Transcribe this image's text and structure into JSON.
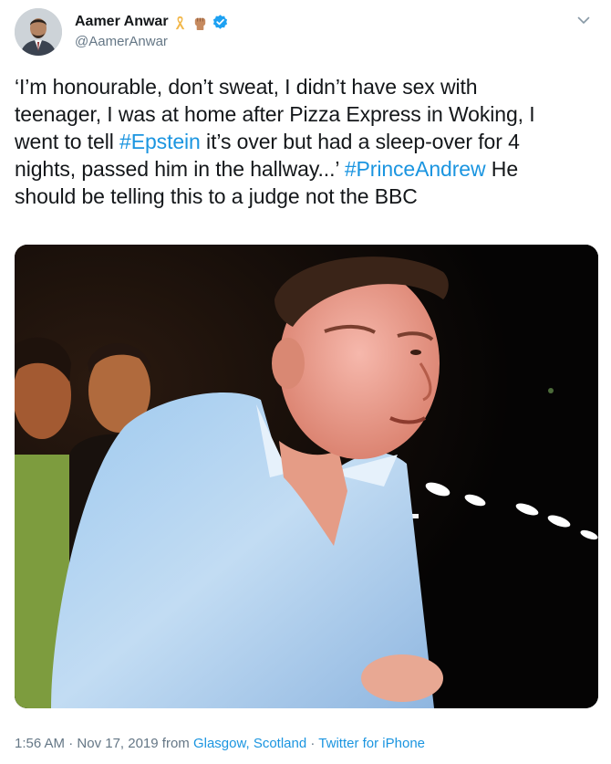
{
  "author": {
    "display_name": "Aamer Anwar",
    "handle": "@AamerAnwar",
    "badges": [
      "awareness-ribbon-icon",
      "raised-fist-icon",
      "verified-badge-icon"
    ]
  },
  "tweet": {
    "lines": [
      [
        {
          "text": "‘I’m honourable, don’t sweat,  I didn’t have sex with"
        }
      ],
      [
        {
          "text": "teenager, I was at home after Pizza Express in Woking, I"
        }
      ],
      [
        {
          "text": "went to tell "
        },
        {
          "text": "#Epstein",
          "hashtag": true
        },
        {
          "text": " it’s over but had a sleep-over for 4"
        }
      ],
      [
        {
          "text": "nights, passed him in the hallway...’ "
        },
        {
          "text": "#PrinceAndrew",
          "hashtag": true
        },
        {
          "text": " He"
        }
      ],
      [
        {
          "text": "should be telling this to a judge not the BBC"
        }
      ]
    ]
  },
  "footer": {
    "time": "1:56 AM",
    "separator": " · ",
    "date": "Nov 17, 2019",
    "from_label": " from ",
    "location": "Glasgow, Scotland",
    "source": "Twitter for iPhone"
  },
  "colors": {
    "link": "#1b95e0",
    "text": "#14171a",
    "secondary": "#657786"
  }
}
